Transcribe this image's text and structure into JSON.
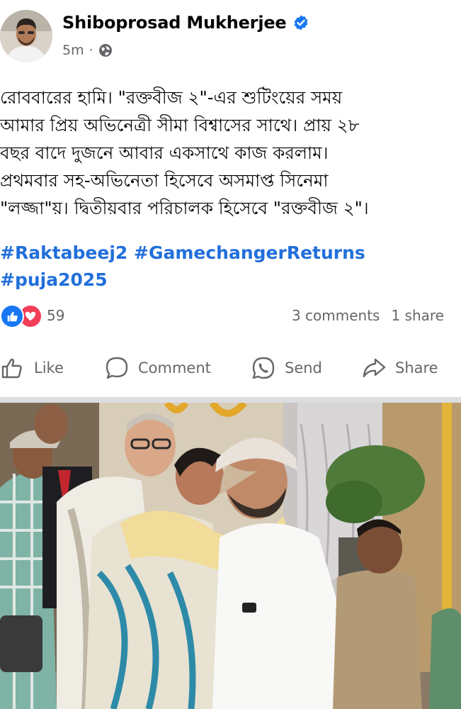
{
  "post": {
    "author": "Shiboprosad Mukherjee",
    "time": "5m",
    "separator": "·",
    "audience_icon": "globe-icon",
    "verified_icon": "verified-badge-icon",
    "text_lines": [
      "রোববারের হামি। \"রক্তবীজ ২\"-এর শুটিংয়ের সময়",
      "আমার প্রিয় অভিনেত্রী সীমা বিশ্বাসের সাথে। প্রায় ২৮",
      "বছর বাদে দুজনে আবার একসাথে কাজ করলাম।",
      "প্রথমবার সহ-অভিনেতা হিসেবে অসমাপ্ত সিনেমা",
      "\"লজ্জা\"য়। দ্বিতীয়বার পরিচালক হিসেবে \"রক্তবীজ ২\"।"
    ],
    "hashtags": [
      "#Raktabeej2",
      "#GamechangerReturns",
      "#puja2025"
    ]
  },
  "stats": {
    "reactions": "59",
    "comments": "3 comments",
    "shares": "1 share",
    "reaction_icons": [
      "like-reaction-icon",
      "love-reaction-icon"
    ]
  },
  "actions": {
    "like": "Like",
    "comment": "Comment",
    "send": "Send",
    "share": "Share"
  },
  "colors": {
    "hashtag": "#216fdb",
    "verified": "#1877f2",
    "like_reaction": "#1877f2",
    "love_reaction": "#f33e58",
    "meta_text": "#65676b"
  }
}
